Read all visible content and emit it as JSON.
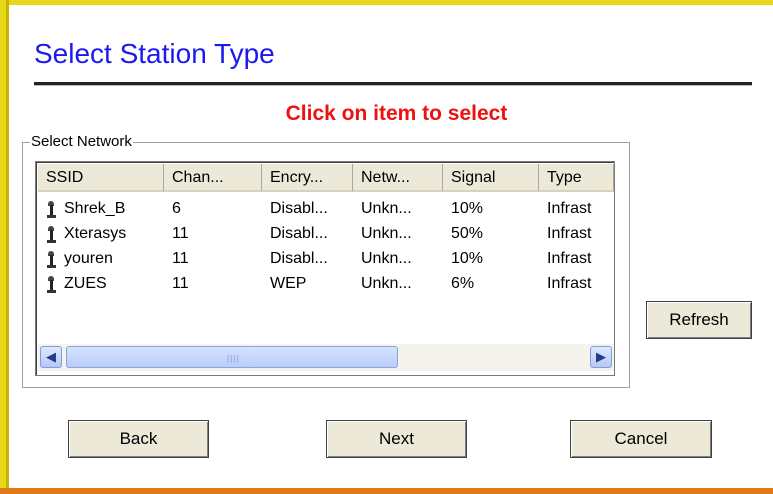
{
  "title": "Select Station Type",
  "instruction": "Click on item to select",
  "group_label": "Select Network",
  "columns": [
    "SSID",
    "Chan...",
    "Encry...",
    "Netw...",
    "Signal",
    "Type"
  ],
  "networks": [
    {
      "ssid": "Shrek_B",
      "channel": "6",
      "encryption": "Disabl...",
      "network": "Unkn...",
      "signal": "10%",
      "type": "Infrast"
    },
    {
      "ssid": "Xterasys",
      "channel": "11",
      "encryption": "Disabl...",
      "network": "Unkn...",
      "signal": "50%",
      "type": "Infrast"
    },
    {
      "ssid": "youren",
      "channel": "11",
      "encryption": "Disabl...",
      "network": "Unkn...",
      "signal": "10%",
      "type": "Infrast"
    },
    {
      "ssid": "ZUES",
      "channel": "11",
      "encryption": "WEP",
      "network": "Unkn...",
      "signal": "6%",
      "type": "Infrast"
    }
  ],
  "network_icon": "antenna-icon",
  "buttons": {
    "refresh": "Refresh",
    "back": "Back",
    "next": "Next",
    "cancel": "Cancel"
  },
  "colors": {
    "title": "#1a1aee",
    "instruction": "#ee1111",
    "frame_yellow": "#e8d81a",
    "frame_orange": "#e07a18"
  }
}
